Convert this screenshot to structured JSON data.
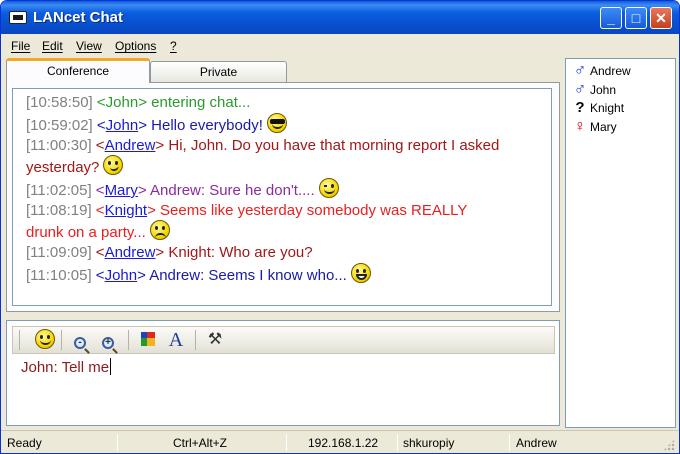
{
  "window": {
    "title": "LANcet Chat",
    "minimize_glyph": "_",
    "maximize_glyph": "□",
    "close_glyph": "✕"
  },
  "menu": {
    "file": "File",
    "edit": "Edit",
    "view": "View",
    "options": "Options",
    "help": "?"
  },
  "tabs": {
    "conference": "Conference",
    "private": "Private",
    "active": "Conference"
  },
  "chat": {
    "colors": {
      "timestamp": "#808080",
      "john_enter": "#2c9a2c",
      "john": "#1a1aa8",
      "andrew": "#a01818",
      "mary": "#8a2ba0",
      "knight": "#e82020",
      "link": "#1a1ad8"
    },
    "messages": [
      {
        "time": "[10:58:50]",
        "open": " <",
        "nick": "John",
        "close": "> ",
        "text": "entering chat...",
        "emoticon": ""
      },
      {
        "time": "[10:59:02]",
        "open": " <",
        "nick": "John",
        "close": "> ",
        "text": "Hello everybody!",
        "emoticon": "cool-smiley"
      },
      {
        "time": "[11:00:30]",
        "open": " <",
        "nick": "Andrew",
        "close": "> ",
        "text": "Hi, John. Do you have that morning report I asked",
        "text2": "yesterday?",
        "emoticon": "smirk-smiley"
      },
      {
        "time": "[11:02:05]",
        "open": " <",
        "nick": "Mary",
        "close": "> ",
        "text": "Andrew: Sure he don't....",
        "emoticon": "wink-smiley"
      },
      {
        "time": "[11:08:19]",
        "open": " <",
        "nick": "Knight",
        "close": "> ",
        "text": "Seems like yesterday somebody was REALLY",
        "text2": "drunk on a party...",
        "emoticon": "sad-smiley"
      },
      {
        "time": "[11:09:09]",
        "open": " <",
        "nick": "Andrew",
        "close": "> ",
        "text": "Knight: Who are you?",
        "emoticon": ""
      },
      {
        "time": "[11:10:05]",
        "open": " <",
        "nick": "John",
        "close": "> ",
        "text": "Andrew: Seems I know who...",
        "emoticon": "grin-smiley"
      }
    ]
  },
  "toolbar": {
    "items": [
      "smiley-icon",
      "zoom-out-icon",
      "zoom-in-icon",
      "color-icon",
      "font-icon",
      "tools-icon"
    ],
    "zoom_out_glyph": "-",
    "zoom_in_glyph": "+",
    "font_glyph": "A",
    "tools_glyph": "⚒"
  },
  "input": {
    "value": "John: Tell me"
  },
  "users": [
    {
      "name": "Andrew",
      "gender_glyph": "♂",
      "icon": "male-icon"
    },
    {
      "name": "John",
      "gender_glyph": "♂",
      "icon": "male-icon"
    },
    {
      "name": "Knight",
      "gender_glyph": "?",
      "icon": "unknown-gender-icon"
    },
    {
      "name": "Mary",
      "gender_glyph": "♀",
      "icon": "female-icon"
    }
  ],
  "status": {
    "state": "Ready",
    "shortcut": "Ctrl+Alt+Z",
    "ip": "192.168.1.22",
    "host": "shkuropiy",
    "user": "Andrew"
  }
}
